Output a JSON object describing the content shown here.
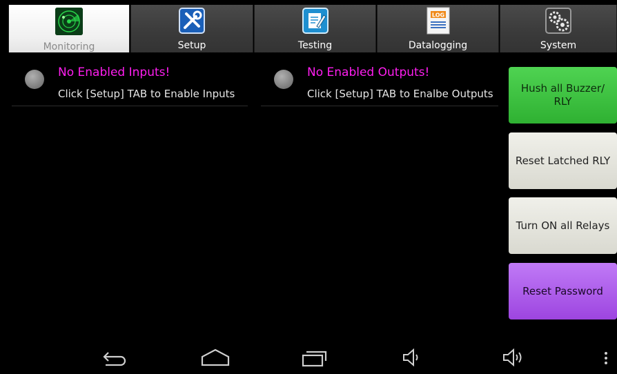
{
  "tabs": [
    {
      "label": "Monitoring",
      "icon": "radar-icon",
      "active": true
    },
    {
      "label": "Setup",
      "icon": "tools-icon",
      "active": false
    },
    {
      "label": "Testing",
      "icon": "edit-icon",
      "active": false
    },
    {
      "label": "Datalogging",
      "icon": "log-icon",
      "active": false
    },
    {
      "label": "System",
      "icon": "gears-icon",
      "active": false
    }
  ],
  "log_icon_text": "LOG",
  "inputs_panel": {
    "title": "No Enabled Inputs!",
    "subtitle": "Click [Setup] TAB to Enable Inputs"
  },
  "outputs_panel": {
    "title": "No Enabled Outputs!",
    "subtitle": "Click [Setup] TAB to Enalbe Outputs"
  },
  "actions": {
    "hush": "Hush all Buzzer/ RLY",
    "reset_latched": "Reset Latched RLY",
    "turn_on_relays": "Turn ON all Relays",
    "reset_password": "Reset Password"
  },
  "colors": {
    "title_magenta": "#ff1ef0",
    "hush_green": "#3cc23f",
    "reset_purple": "#ad5ceb"
  },
  "navbar": [
    "back-icon",
    "home-icon",
    "recent-apps-icon",
    "volume-down-icon",
    "volume-up-icon",
    "overflow-menu-icon"
  ]
}
